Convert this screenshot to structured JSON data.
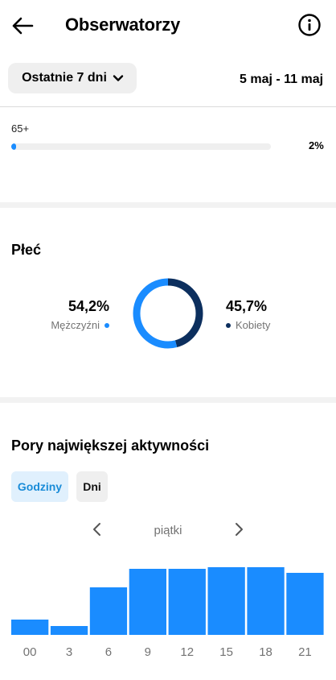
{
  "header": {
    "title": "Obserwatorzy"
  },
  "filter": {
    "range_label": "Ostatnie 7 dni",
    "dates": "5 maj - 11 maj"
  },
  "age": {
    "label": "65+",
    "fraction": 0.02,
    "percent_text": "2%"
  },
  "gender": {
    "title": "Płeć",
    "male": {
      "percent_text": "54,2%",
      "label": "Mężczyźni",
      "value": 54.2
    },
    "female": {
      "percent_text": "45,7%",
      "label": "Kobiety",
      "value": 45.7
    },
    "colors": {
      "male": "#1a8cff",
      "female": "#0c2f5e"
    }
  },
  "activity": {
    "title": "Pory największej aktywności",
    "tabs": {
      "hours": "Godziny",
      "days": "Dni"
    },
    "day": "piątki"
  },
  "colors": {
    "accent": "#1a8cff",
    "dark_accent": "#0c2f5e",
    "pill_bg": "#e0f0fd"
  },
  "chart_data": {
    "type": "bar",
    "categories": [
      "00",
      "3",
      "6",
      "9",
      "12",
      "15",
      "18",
      "21"
    ],
    "values": [
      19,
      11,
      59,
      82,
      82,
      84,
      84,
      77
    ],
    "ylim": [
      0,
      100
    ],
    "grid": false,
    "color": "#1a8cff"
  }
}
